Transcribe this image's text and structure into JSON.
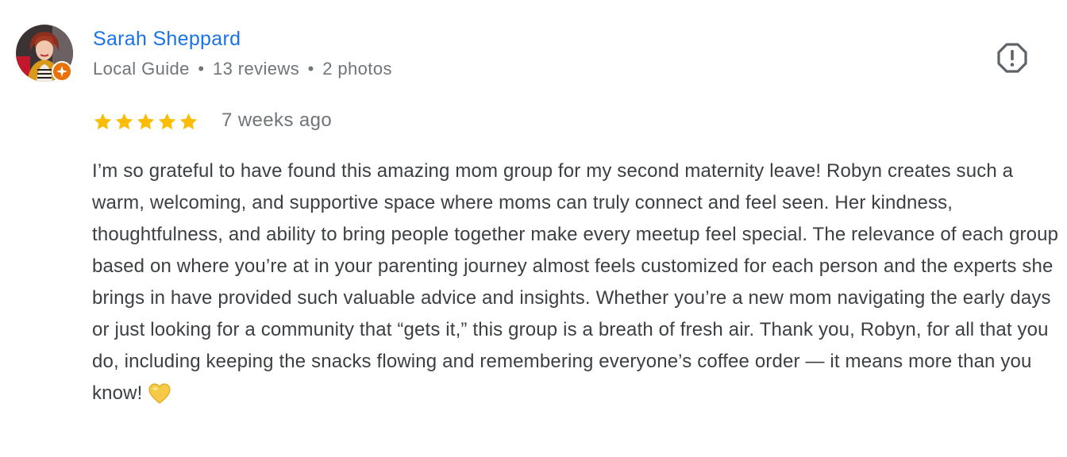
{
  "reviewer": {
    "name": "Sarah Sheppard",
    "badge": "Local Guide",
    "reviews": "13 reviews",
    "photos": "2 photos",
    "separator": "•"
  },
  "rating": {
    "stars": 5,
    "max": 5,
    "time": "7 weeks ago"
  },
  "review": {
    "text": "I’m so grateful to have found this amazing mom group for my second maternity leave! Robyn creates such a warm, welcoming, and supportive space where moms can truly connect and feel seen. Her kindness, thoughtfulness, and ability to bring people together make every meetup feel special. The relevance of each group based on where you’re at in your parenting journey almost feels customized for each person and the experts she brings in have provided such valuable advice and insights. Whether you’re a new mom navigating the early days or just looking for a community that “gets it,” this group is a breath of fresh air. Thank you, Robyn, for all that you do, including keeping the snacks flowing and remembering everyone’s coffee order — it means more than you know!",
    "emoji": "yellow-heart-icon"
  },
  "icons": {
    "report": "report-flag-icon",
    "star": "star-icon",
    "guide_badge": "local-guide-badge-icon"
  },
  "colors": {
    "name_link": "#1a73e8",
    "meta_text": "#70757a",
    "body_text": "#3c4043",
    "star": "#fbbc04",
    "badge": "#e8710a"
  }
}
